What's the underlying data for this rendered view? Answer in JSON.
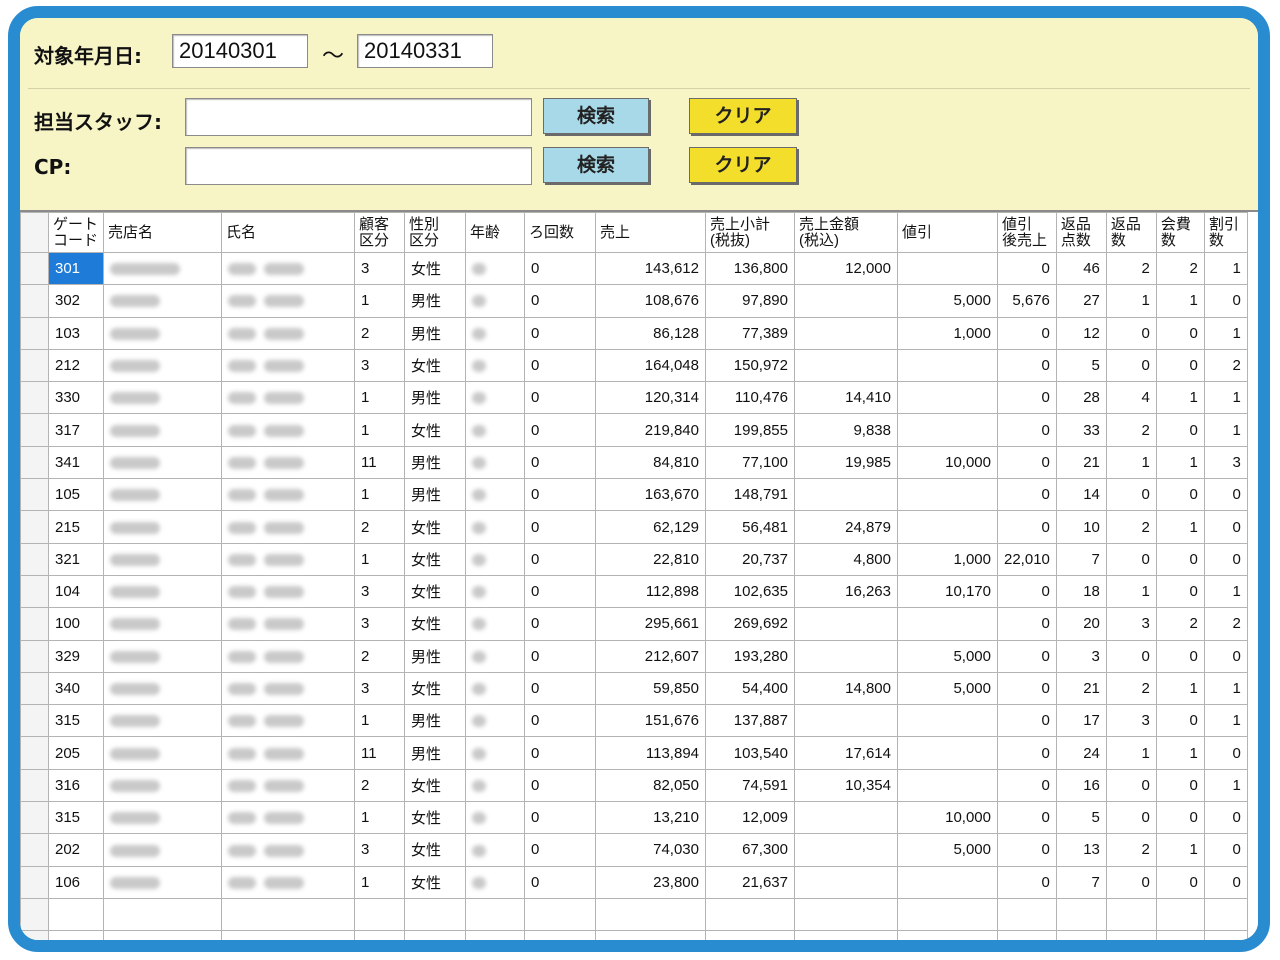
{
  "filters": {
    "date_label": "対象年月日:",
    "date_from": "20140301",
    "date_sep": "～",
    "date_to": "20140331",
    "staff_label": "担当スタッフ:",
    "staff_value": "",
    "cp_label": "CP:",
    "cp_value": "",
    "search_label": "検索",
    "clear_label": "クリア"
  },
  "colors": {
    "frame": "#2a8cd0",
    "panel_bg": "#f7f4c6",
    "search_btn": "#a8d9e8",
    "clear_btn": "#f4de2c",
    "selection": "#1e7bd8"
  },
  "table": {
    "headers": [
      "ゲート\nコード",
      "売店名",
      "氏名",
      "顧客\n区分",
      "性別\n区分",
      "年齢",
      "ろ回数",
      "売上",
      "売上小計\n(税抜)",
      "売上金額\n(税込)",
      "値引",
      "値引\n後売上",
      "返品\n点数",
      "返品\n数",
      "会費\n数",
      "割引\n数"
    ],
    "rows": [
      [
        "301",
        "3",
        "女性",
        "0",
        "143,612",
        "136,800",
        "12,000",
        "",
        "0",
        "46",
        "2",
        "2",
        "1"
      ],
      [
        "302",
        "1",
        "男性",
        "0",
        "108,676",
        "97,890",
        "",
        "5,000",
        "5,676",
        "27",
        "1",
        "1",
        "0"
      ],
      [
        "103",
        "2",
        "男性",
        "0",
        "86,128",
        "77,389",
        "",
        "1,000",
        "0",
        "12",
        "0",
        "0",
        "1"
      ],
      [
        "212",
        "3",
        "女性",
        "0",
        "164,048",
        "150,972",
        "",
        "",
        "0",
        "5",
        "0",
        "0",
        "2"
      ],
      [
        "330",
        "1",
        "男性",
        "0",
        "120,314",
        "110,476",
        "14,410",
        "",
        "0",
        "28",
        "4",
        "1",
        "1"
      ],
      [
        "317",
        "1",
        "女性",
        "0",
        "219,840",
        "199,855",
        "9,838",
        "",
        "0",
        "33",
        "2",
        "0",
        "1"
      ],
      [
        "341",
        "11",
        "男性",
        "0",
        "84,810",
        "77,100",
        "19,985",
        "10,000",
        "0",
        "21",
        "1",
        "1",
        "3"
      ],
      [
        "105",
        "1",
        "男性",
        "0",
        "163,670",
        "148,791",
        "",
        "",
        "0",
        "14",
        "0",
        "0",
        "0"
      ],
      [
        "215",
        "2",
        "女性",
        "0",
        "62,129",
        "56,481",
        "24,879",
        "",
        "0",
        "10",
        "2",
        "1",
        "0"
      ],
      [
        "321",
        "1",
        "女性",
        "0",
        "22,810",
        "20,737",
        "4,800",
        "1,000",
        "22,010",
        "7",
        "0",
        "0",
        "0"
      ],
      [
        "104",
        "3",
        "女性",
        "0",
        "112,898",
        "102,635",
        "16,263",
        "10,170",
        "0",
        "18",
        "1",
        "0",
        "1"
      ],
      [
        "100",
        "3",
        "女性",
        "0",
        "295,661",
        "269,692",
        "",
        "",
        "0",
        "20",
        "3",
        "2",
        "2"
      ],
      [
        "329",
        "2",
        "男性",
        "0",
        "212,607",
        "193,280",
        "",
        "5,000",
        "0",
        "3",
        "0",
        "0",
        "0"
      ],
      [
        "340",
        "3",
        "女性",
        "0",
        "59,850",
        "54,400",
        "14,800",
        "5,000",
        "0",
        "21",
        "2",
        "1",
        "1"
      ],
      [
        "315",
        "1",
        "男性",
        "0",
        "151,676",
        "137,887",
        "",
        "",
        "0",
        "17",
        "3",
        "0",
        "1"
      ],
      [
        "205",
        "11",
        "男性",
        "0",
        "113,894",
        "103,540",
        "17,614",
        "",
        "0",
        "24",
        "1",
        "1",
        "0"
      ],
      [
        "316",
        "2",
        "女性",
        "0",
        "82,050",
        "74,591",
        "10,354",
        "",
        "0",
        "16",
        "0",
        "0",
        "1"
      ],
      [
        "315",
        "1",
        "女性",
        "0",
        "13,210",
        "12,009",
        "",
        "10,000",
        "0",
        "5",
        "0",
        "0",
        "0"
      ],
      [
        "202",
        "3",
        "女性",
        "0",
        "74,030",
        "67,300",
        "",
        "5,000",
        "0",
        "13",
        "2",
        "1",
        "0"
      ],
      [
        "106",
        "1",
        "女性",
        "0",
        "23,800",
        "21,637",
        "",
        "",
        "0",
        "7",
        "0",
        "0",
        "0"
      ]
    ]
  }
}
